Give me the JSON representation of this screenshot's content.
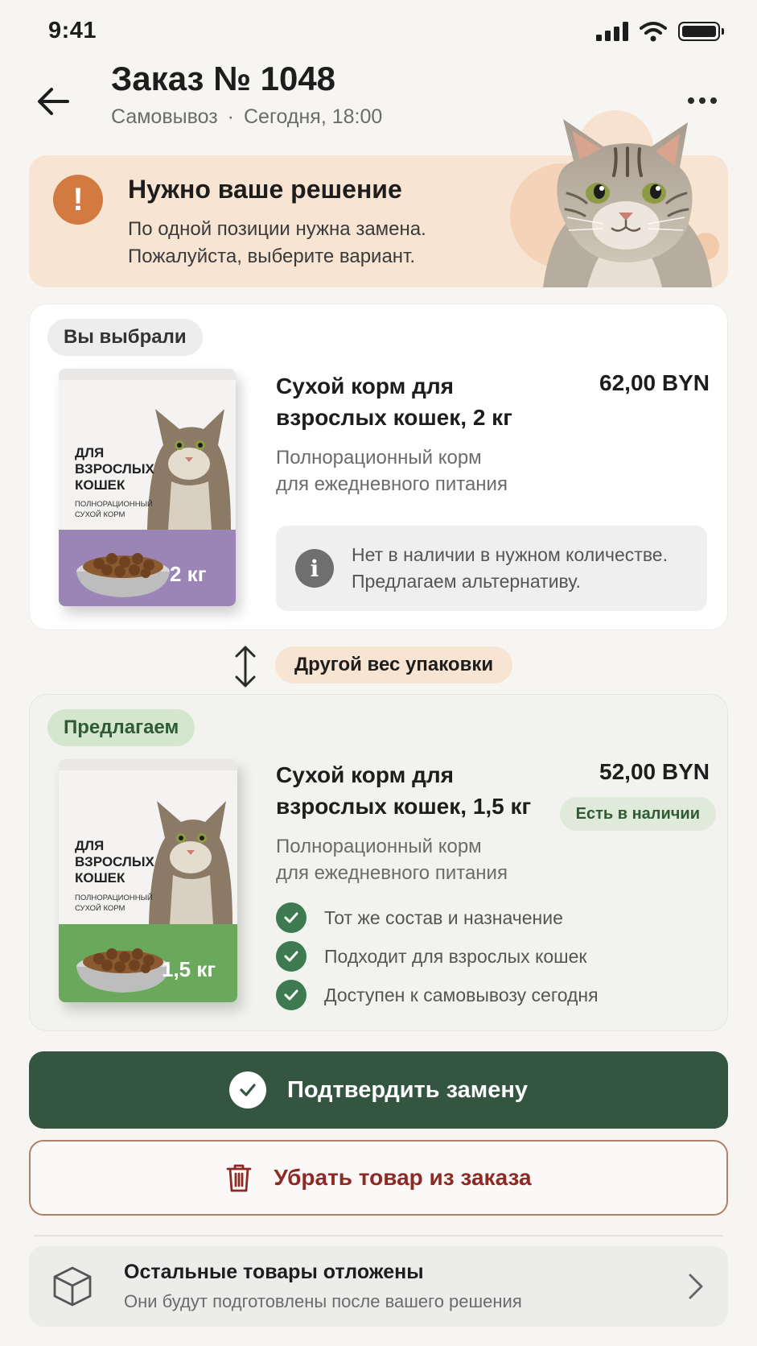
{
  "status_bar": {
    "time": "9:41"
  },
  "header": {
    "title": "Заказ № 1048",
    "pickup": "Самовывоз",
    "separator": "·",
    "time": "Сегодня, 18:00"
  },
  "alert": {
    "icon": "!",
    "title": "Нужно ваше решение",
    "line1": "По одной позиции нужна замена.",
    "line2": "Пожалуйста, выберите вариант."
  },
  "chosen": {
    "badge": "Вы выбрали",
    "title": "Сухой корм для взрослых кошек, 2 кг",
    "price": "62,00 BYN",
    "desc_line1": "Полнорационный корм",
    "desc_line2": "для ежедневного питания",
    "info_line1": "Нет в наличии в нужном количестве.",
    "info_line2": "Предлагаем альтернативу.",
    "pack": {
      "line1": "ДЛЯ",
      "line2": "ВЗРОСЛЫХ",
      "line3": "КОШЕК",
      "small1": "ПОЛНОРАЦИОННЫЙ",
      "small2": "СУХОЙ КОРМ",
      "weight": "2 кг",
      "band_color": "#9b84b6"
    }
  },
  "swap": {
    "label": "Другой вес упаковки"
  },
  "suggested": {
    "badge": "Предлагаем",
    "title": "Сухой корм для взрослых кошек, 1,5 кг",
    "price": "52,00 BYN",
    "stock": "Есть в наличии",
    "desc_line1": "Полнорационный корм",
    "desc_line2": "для ежедневного питания",
    "checks": [
      "Тот же состав и назначение",
      "Подходит для взрослых кошек",
      "Доступен к самовывозу сегодня"
    ],
    "pack": {
      "line1": "ДЛЯ",
      "line2": "ВЗРОСЛЫХ",
      "line3": "КОШЕК",
      "small1": "ПОЛНОРАЦИОННЫЙ",
      "small2": "СУХОЙ КОРМ",
      "weight": "1,5 кг",
      "band_color": "#6aa85c"
    }
  },
  "actions": {
    "confirm": "Подтвердить замену",
    "remove": "Убрать товар из заказа"
  },
  "footer": {
    "title": "Остальные товары отложены",
    "subtitle": "Они будут подготовлены после вашего решения"
  },
  "colors": {
    "accent_green": "#345540",
    "alert_bg": "#f8e4d3",
    "alert_icon": "#d27a40",
    "remove_red": "#8e2a24"
  }
}
